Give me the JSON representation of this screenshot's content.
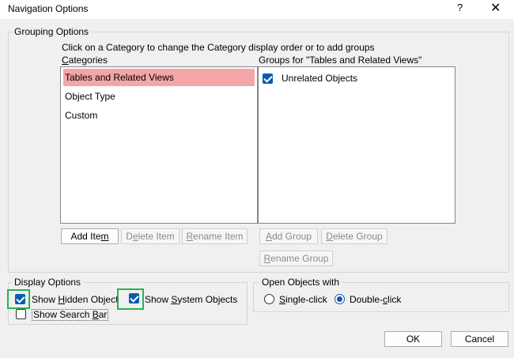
{
  "window": {
    "title": "Navigation Options",
    "help": "?",
    "close": "✕"
  },
  "grouping": {
    "legend": "Grouping Options",
    "instruction": "Click on a Category to change the Category display order or to add groups",
    "categories_label": "Categories",
    "categories": [
      "Tables and Related Views",
      "Object Type",
      "Custom"
    ],
    "groups_label": "Groups for \"Tables and Related Views\"",
    "groups": [
      {
        "label": "Unrelated Objects",
        "checked": true
      }
    ],
    "buttons": {
      "add_item": "Add Item",
      "delete_item": "Delete Item",
      "rename_item": "Rename Item",
      "add_group": "Add Group",
      "delete_group": "Delete Group",
      "rename_group": "Rename Group"
    }
  },
  "display": {
    "legend": "Display Options",
    "show_hidden": {
      "label": "Show Hidden Object",
      "checked": true
    },
    "show_system": {
      "label": "Show System Objects",
      "checked": true
    },
    "show_search": {
      "label": "Show Search Bar",
      "checked": false
    }
  },
  "open_objects": {
    "legend": "Open Objects with",
    "single": {
      "label": "Single-click",
      "selected": false
    },
    "double": {
      "label": "Double-click",
      "selected": true
    }
  },
  "footer": {
    "ok": "OK",
    "cancel": "Cancel"
  },
  "colors": {
    "selection": "#f4a6a6",
    "highlight": "#2bb24c",
    "accent": "#0b5cad"
  }
}
